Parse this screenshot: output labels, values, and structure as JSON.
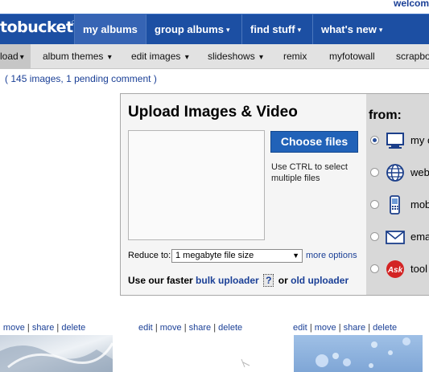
{
  "header": {
    "welcome": "welcom"
  },
  "topnav": {
    "logo": "tobucket",
    "tabs": [
      {
        "label": "my albums",
        "caret": ""
      },
      {
        "label": "group albums",
        "caret": "▾"
      },
      {
        "label": "find stuff",
        "caret": "▾"
      },
      {
        "label": "what's new",
        "caret": "▾"
      }
    ]
  },
  "subnav": {
    "items": [
      {
        "label": "load",
        "caret": "▾"
      },
      {
        "label": "album themes",
        "caret": "▾"
      },
      {
        "label": "edit images",
        "caret": "▾"
      },
      {
        "label": "slideshows",
        "caret": "▾"
      },
      {
        "label": "remix",
        "caret": ""
      },
      {
        "label": "myfotowall",
        "caret": ""
      },
      {
        "label": "scrapbo",
        "caret": ""
      }
    ]
  },
  "album_counts": {
    "open": "(",
    "images": "145 images",
    "comma": ",",
    "comments": "1 pending comment",
    "close": ")"
  },
  "upload": {
    "title": "Upload Images & Video",
    "choose_button": "Choose files",
    "ctrl_hint": "Use CTRL to select multiple files",
    "reduce_label": "Reduce to:",
    "reduce_value": "1 megabyte file size",
    "more_options": "more options",
    "faster_prefix": "Use our faster",
    "bulk_uploader": "bulk uploader",
    "help": "?",
    "or": "or",
    "old_uploader": "old uploader",
    "from_title": "from:",
    "sources": [
      {
        "label": "my c",
        "icon": "computer-icon",
        "selected": true
      },
      {
        "label": "web",
        "icon": "globe-icon",
        "selected": false
      },
      {
        "label": "mob",
        "icon": "mobile-phone-icon",
        "selected": false
      },
      {
        "label": "ema",
        "icon": "envelope-icon",
        "selected": false
      },
      {
        "label": "tool",
        "icon": "ask-icon",
        "selected": false
      }
    ]
  },
  "photos": [
    {
      "edit": "",
      "move": "move",
      "share": "share",
      "delete": "delete"
    },
    {
      "edit": "edit",
      "move": "move",
      "share": "share",
      "delete": "delete"
    },
    {
      "edit": "edit",
      "move": "move",
      "share": "share",
      "delete": "delete"
    }
  ],
  "colors": {
    "nav_blue": "#1c4fa3",
    "link_blue": "#1a3f96",
    "button_blue": "#2162b8"
  }
}
